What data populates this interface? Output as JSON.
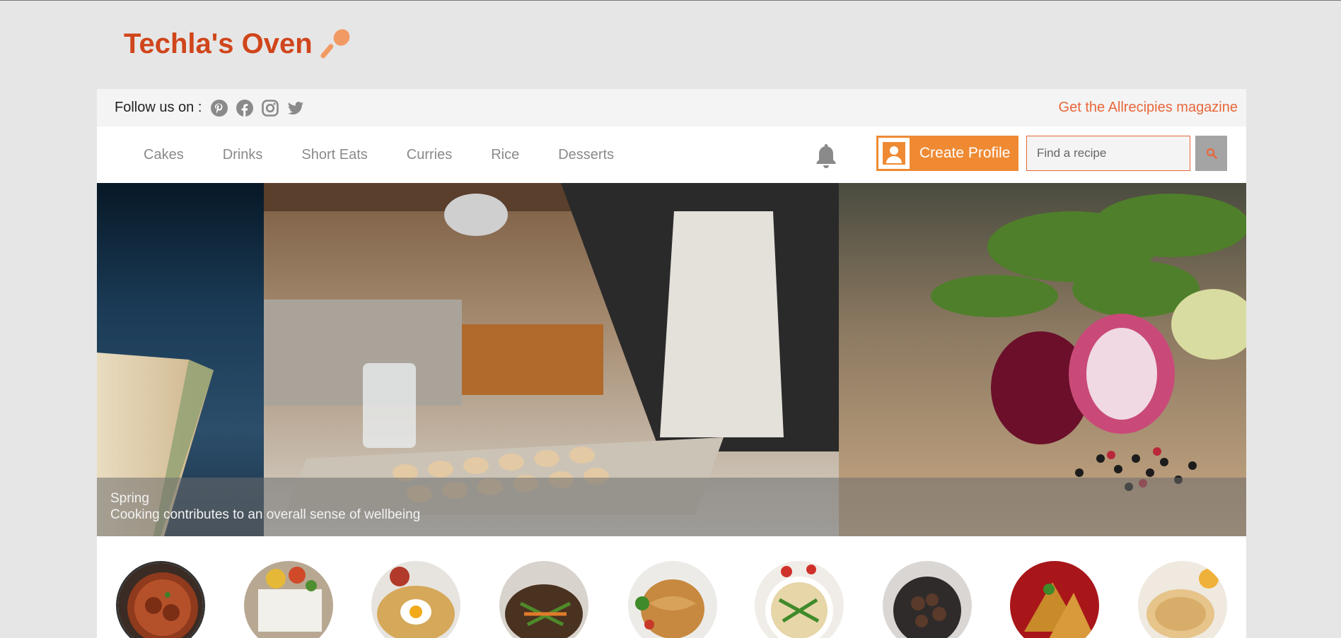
{
  "brand": {
    "name": "Techla's Oven",
    "accent": "#d0451b",
    "icon": "spoon-icon"
  },
  "topbar": {
    "follow_label": "Follow us on :",
    "social": [
      "pinterest-icon",
      "facebook-icon",
      "instagram-icon",
      "twitter-icon"
    ],
    "magazine_link": "Get the Allrecipies magazine"
  },
  "nav": {
    "links": [
      "Cakes",
      "Drinks",
      "Short Eats",
      "Curries",
      "Rice",
      "Desserts"
    ],
    "create_profile": "Create Profile",
    "search_placeholder": "Find a recipe"
  },
  "hero": {
    "caption_title": "Spring",
    "caption_text": "Cooking contributes to an overall sense of wellbeing"
  },
  "categories": [
    "curry",
    "rice",
    "hoppers",
    "vegetables",
    "noodles",
    "salad",
    "devilled-meat",
    "samosa",
    "roti"
  ],
  "colors": {
    "accent_orange": "#ef8a33",
    "link_orange": "#e8673a",
    "background": "#e6e6e6"
  }
}
